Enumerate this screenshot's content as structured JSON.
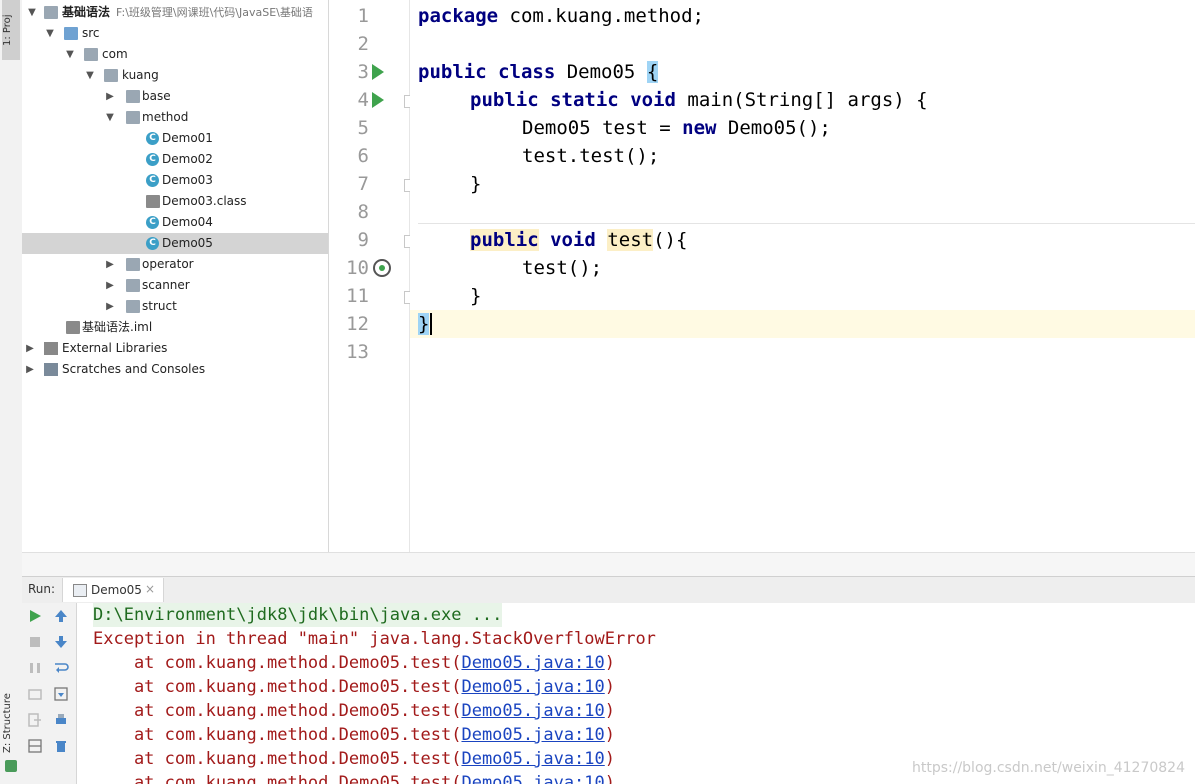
{
  "sidebar_tabs": {
    "project": "1: Proj",
    "structure": "Z: Structure"
  },
  "project_tree": {
    "rows": [
      {
        "label": "基础语法",
        "path": "F:\\班级管理\\网课班\\代码\\JavaSE\\基础语",
        "icon": "module-folder-icon"
      },
      {
        "label": "src",
        "icon": "source-folder-icon"
      },
      {
        "label": "com",
        "icon": "package-icon"
      },
      {
        "label": "kuang",
        "icon": "package-icon"
      },
      {
        "label": "base",
        "icon": "package-icon"
      },
      {
        "label": "method",
        "icon": "package-icon"
      },
      {
        "label": "Demo01",
        "icon": "java-class-icon"
      },
      {
        "label": "Demo02",
        "icon": "java-class-icon"
      },
      {
        "label": "Demo03",
        "icon": "java-class-icon"
      },
      {
        "label": "Demo03.class",
        "icon": "class-file-icon"
      },
      {
        "label": "Demo04",
        "icon": "java-class-icon"
      },
      {
        "label": "Demo05",
        "icon": "java-class-icon",
        "selected": true
      },
      {
        "label": "operator",
        "icon": "package-icon"
      },
      {
        "label": "scanner",
        "icon": "package-icon"
      },
      {
        "label": "struct",
        "icon": "package-icon"
      },
      {
        "label": "基础语法.iml",
        "icon": "iml-file-icon"
      },
      {
        "label": "External Libraries",
        "icon": "libraries-icon"
      },
      {
        "label": "Scratches and Consoles",
        "icon": "scratches-icon"
      }
    ]
  },
  "editor": {
    "line_numbers": [
      "1",
      "2",
      "3",
      "4",
      "5",
      "6",
      "7",
      "8",
      "9",
      "10",
      "11",
      "12",
      "13"
    ],
    "lines": {
      "l1_kw": "package",
      "l1_rest": " com.kuang.method;",
      "l3_kw1": "public",
      "l3_kw2": "class",
      "l3_name": " Demo05 ",
      "l3_brace": "{",
      "l4_kw1": "public",
      "l4_kw2": "static",
      "l4_kw3": "void",
      "l4_rest": " main(String[] args) {",
      "l5_a": "Demo05 test = ",
      "l5_kw": "new",
      "l5_b": " Demo05();",
      "l6": "test.test();",
      "l7": "}",
      "l9_kw1": "public",
      "l9_kw2": "void",
      "l9_name": "test",
      "l9_rest": "(){",
      "l10": "test();",
      "l11": "}",
      "l12": "}"
    }
  },
  "run_panel": {
    "label": "Run:",
    "tab": "Demo05",
    "tab_close": "×",
    "console": {
      "command": "D:\\Environment\\jdk8\\jdk\\bin\\java.exe ...",
      "exception": "Exception in thread \"main\" java.lang.StackOverflowError",
      "stack_prefix": "    at com.kuang.method.Demo05.test(",
      "stack_link": "Demo05.java:10",
      "stack_suffix": ")"
    }
  },
  "watermark": "https://blog.csdn.net/weixin_41270824",
  "colors": {
    "keyword": "#000080",
    "error": "#a21a1a",
    "link": "#1a44c0",
    "run_green": "#3fa34d"
  }
}
